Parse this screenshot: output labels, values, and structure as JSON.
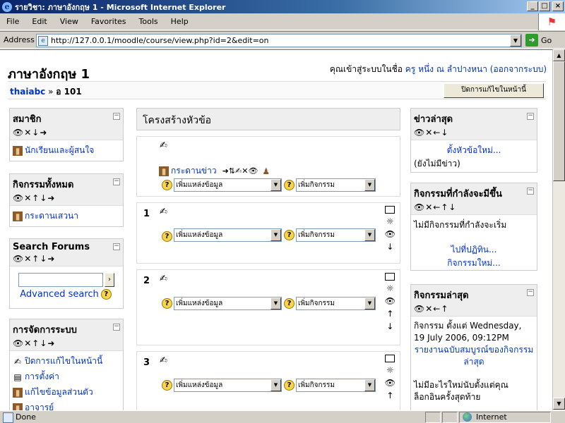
{
  "window": {
    "title": "รายวิชา: ภาษาอังกฤษ 1 - Microsoft Internet Explorer",
    "btn_min": "_",
    "btn_max": "□",
    "btn_close": "×"
  },
  "menu": [
    "File",
    "Edit",
    "View",
    "Favorites",
    "Tools",
    "Help"
  ],
  "address": {
    "label": "Address",
    "url": "http://127.0.0.1/moodle/course/view.php?id=2&edit=on",
    "go": "Go"
  },
  "page": {
    "course_title": "ภาษาอังกฤษ 1",
    "login_prefix": "คุณเข้าสู่ระบบในชื่อ ",
    "user_name": "ครู หนึ่ง ณ ลำปางหนา",
    "logout": "(ออกจากระบบ)",
    "breadcrumb_site": "thaiabc",
    "breadcrumb_sep": " » ",
    "breadcrumb_course": "อ 101",
    "edit_off_button": "ปิดการแก้ไขในหน้านี้"
  },
  "left_blocks": {
    "members": {
      "title": "สมาชิก",
      "controls": "👁✕↓➜",
      "item": "นักเรียนและผู้สนใจ"
    },
    "activities": {
      "title": "กิจกรรมทั้งหมด",
      "controls": "👁✕↑↓➜",
      "item": "กระดานเสวนา"
    },
    "search": {
      "title": "Search Forums",
      "controls": "👁✕↑↓➜",
      "go": "›",
      "advanced": "Advanced search"
    },
    "admin": {
      "title": "การจัดการระบบ",
      "controls": "👁✕↑↓➜",
      "items": [
        "ปิดการแก้ไขในหน้านี้",
        "การตั้งค่า",
        "แก้ไขข้อมูลส่วนตัว",
        "อาจารย์"
      ]
    }
  },
  "center": {
    "header": "โครงสร้างหัวข้อ",
    "news_forum": "กระดานข่าว",
    "news_controls": "➜⇅✍✕👁",
    "add_resource": "เพิ่มแหล่งข้อมูล",
    "add_activity": "เพิ่มกิจกรรม",
    "section_numbers": [
      "1",
      "2",
      "3"
    ]
  },
  "right_blocks": {
    "news": {
      "title": "ข่าวล่าสุด",
      "controls": "👁✕←↓",
      "add": "ตั้งหัวข้อใหม่...",
      "none": "(ยังไม่มีข่าว)"
    },
    "upcoming": {
      "title": "กิจกรรมที่กำลังจะมีขึ้น",
      "controls": "👁✕←↑↓",
      "none": "ไม่มีกิจกรรมที่กำลังจะเริ่ม",
      "calendar": "ไปที่ปฏิทิน...",
      "new_event": "กิจกรรมใหม่..."
    },
    "recent": {
      "title": "กิจกรรมล่าสุด",
      "controls": "👁✕←↑",
      "since": "กิจกรรม ตั้งแต่ Wednesday, 19 July 2006, 09:12PM",
      "full_report": "รายงานฉบับสมบูรณ์ของกิจกรรมล่าสุด",
      "nothing": "ไม่มีอะไรใหม่นับตั้งแต่คุณล็อกอินครั้งสุดท้าย"
    }
  },
  "status": {
    "done": "Done",
    "zone": "Internet"
  }
}
